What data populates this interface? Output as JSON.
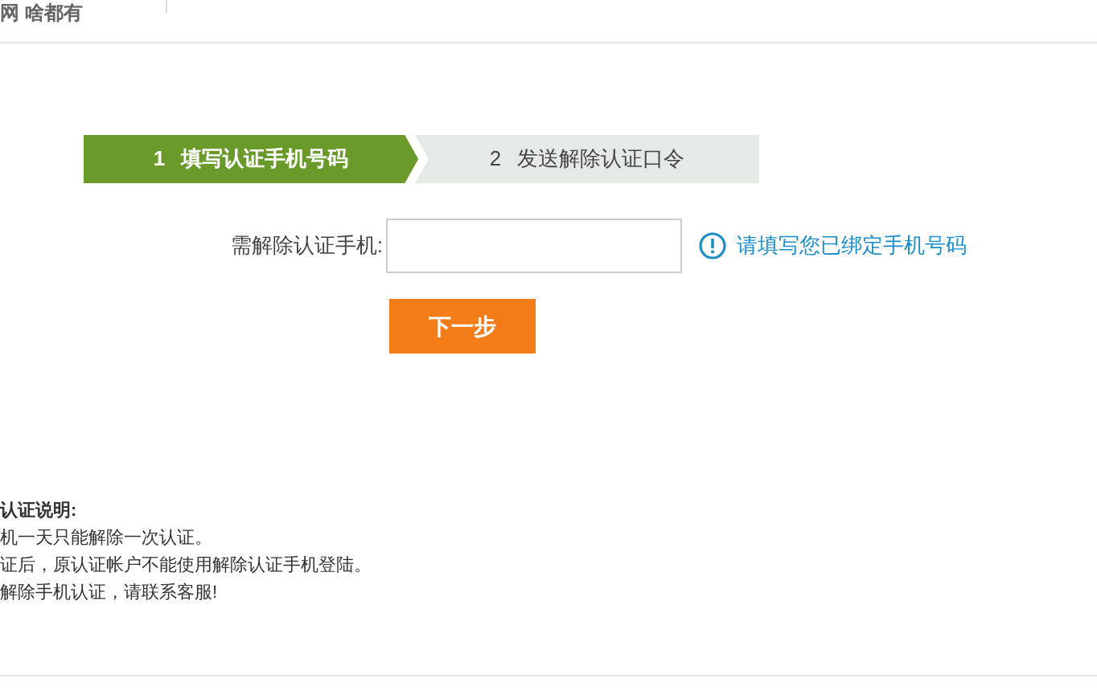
{
  "header": {
    "title": "网 啥都有"
  },
  "steps": [
    {
      "number": "1",
      "label": "填写认证手机号码",
      "selected": true
    },
    {
      "number": "2",
      "label": "发送解除认证口令",
      "selected": false
    }
  ],
  "form": {
    "label": "需解除认证手机:",
    "hint": "请填写您已绑定手机号码",
    "button": "下一步"
  },
  "notes": {
    "title": "认证说明:",
    "lines": [
      "机一天只能解除一次认证。",
      "证后，原认证帐户不能使用解除认证手机登陆。",
      "解除手机认证，请联系客服!"
    ]
  }
}
